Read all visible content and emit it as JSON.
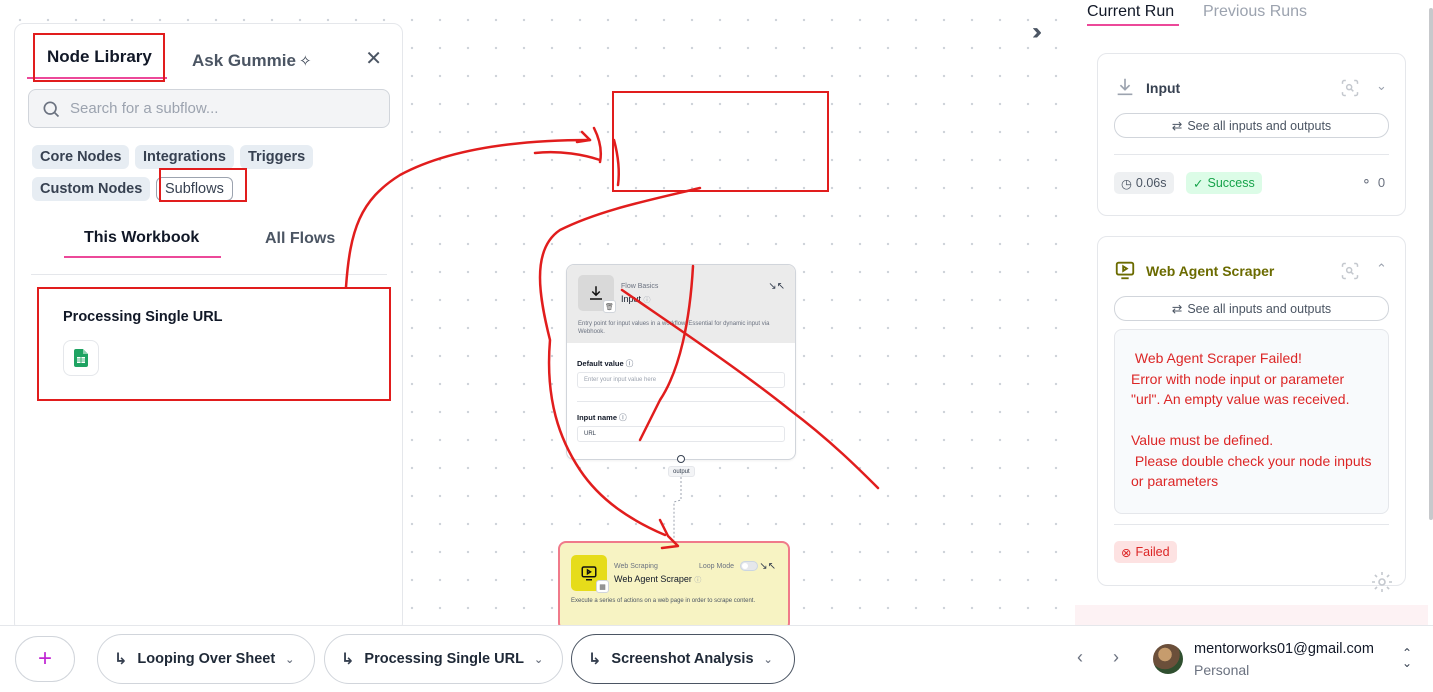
{
  "left_panel": {
    "tabs": {
      "node_library": "Node Library",
      "ask_gummie": "Ask Gummie"
    },
    "search_placeholder": "Search for a subflow...",
    "chips": [
      "Core Nodes",
      "Integrations",
      "Triggers",
      "Custom Nodes",
      "Subflows"
    ],
    "selected_chip": "Subflows",
    "sub_tabs": {
      "this_workbook": "This Workbook",
      "all_flows": "All Flows"
    },
    "flows": [
      {
        "title": "Processing Single URL",
        "icon": "google-sheets-icon"
      }
    ]
  },
  "canvas": {
    "input_node": {
      "category": "Flow Basics",
      "name": "Input",
      "description": "Entry point for input values in a workflow. Essential for dynamic input via Webhook.",
      "default_value_label": "Default value",
      "default_value_placeholder": "Enter your input value here",
      "input_name_label": "Input name",
      "input_name_value": "URL",
      "output_label": "output"
    },
    "scraper_node": {
      "category": "Web Scraping",
      "name": "Web Agent Scraper",
      "loop_mode_label": "Loop Mode",
      "loop_mode": false,
      "description": "Execute a series of actions on a web page in order to scrape content."
    }
  },
  "right_panel": {
    "tabs": {
      "current_run": "Current Run",
      "previous_runs": "Previous Runs"
    },
    "input_card": {
      "title": "Input",
      "io_button": "See all inputs and outputs",
      "duration": "0.06s",
      "status": "Success",
      "credits": "0"
    },
    "scraper_card": {
      "title": "Web Agent Scraper",
      "io_button": "See all inputs and outputs",
      "error": " Web Agent Scraper Failed!\nError with node input or parameter \"url\". An empty value was received.\n\nValue must be defined.\n Please double check your node inputs or parameters",
      "status": "Failed"
    }
  },
  "bottom_bar": {
    "flows": [
      "Looping Over Sheet",
      "Processing Single URL",
      "Screenshot Analysis"
    ],
    "active_flow": "Screenshot Analysis",
    "user_email": "mentorworks01@gmail.com",
    "user_plan": "Personal"
  },
  "colors": {
    "accent_pink": "#ec4899",
    "annotation_red": "#e11d1d",
    "success_green": "#16a34a",
    "error_red": "#dc2626",
    "scraper_yellow": "#f7f3c3"
  }
}
